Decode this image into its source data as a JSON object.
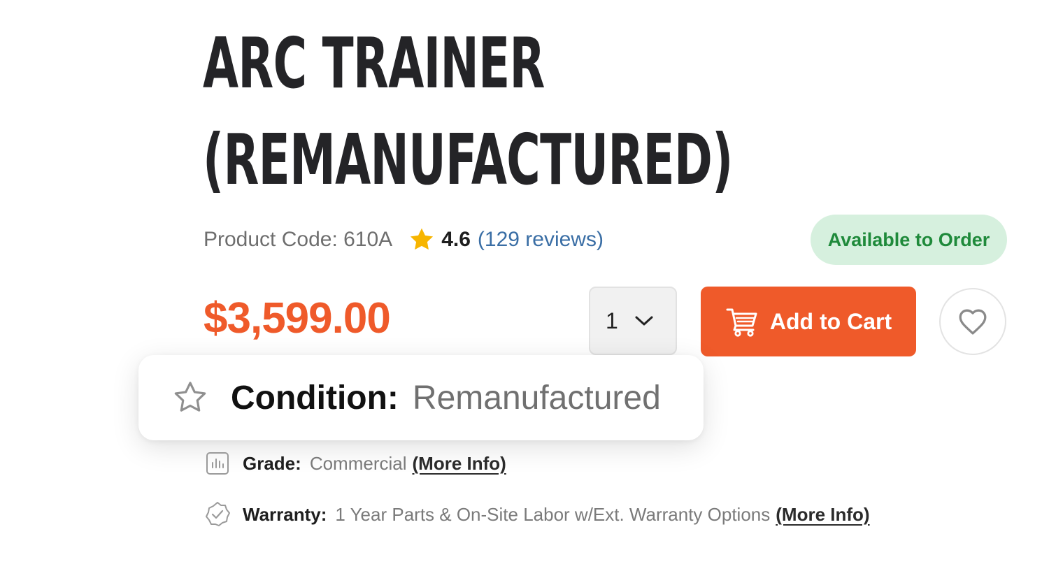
{
  "product": {
    "title_line1": "ARC TRAINER",
    "title_line2": "(REMANUFACTURED)",
    "product_code": "Product Code: 610A",
    "rating": "4.6",
    "reviews": "(129 reviews)",
    "availability": "Available to Order",
    "price": "$3,599.00"
  },
  "purchase": {
    "quantity": "1",
    "add_to_cart_label": "Add to Cart"
  },
  "condition": {
    "label": "Condition:",
    "value": "Remanufactured"
  },
  "specs": [
    {
      "label": "Grade:",
      "value": "Commercial",
      "link": "(More Info)",
      "icon": "bar-chart-icon"
    },
    {
      "label": "Warranty:",
      "value": "1 Year Parts & On-Site Labor w/Ext. Warranty Options",
      "link": "(More Info)",
      "icon": "badge-check-icon"
    }
  ],
  "colors": {
    "accent": "#ef5a2a",
    "title": "#242427",
    "link": "#3a6ea5",
    "badge_bg": "#d6f0de",
    "badge_text": "#1f8a3b",
    "star": "#f7b500"
  },
  "icons": {
    "rating": "star-filled-icon",
    "quantity": "chevron-down-icon",
    "cart": "shopping-cart-icon",
    "wishlist": "heart-icon",
    "condition": "star-outline-icon"
  }
}
